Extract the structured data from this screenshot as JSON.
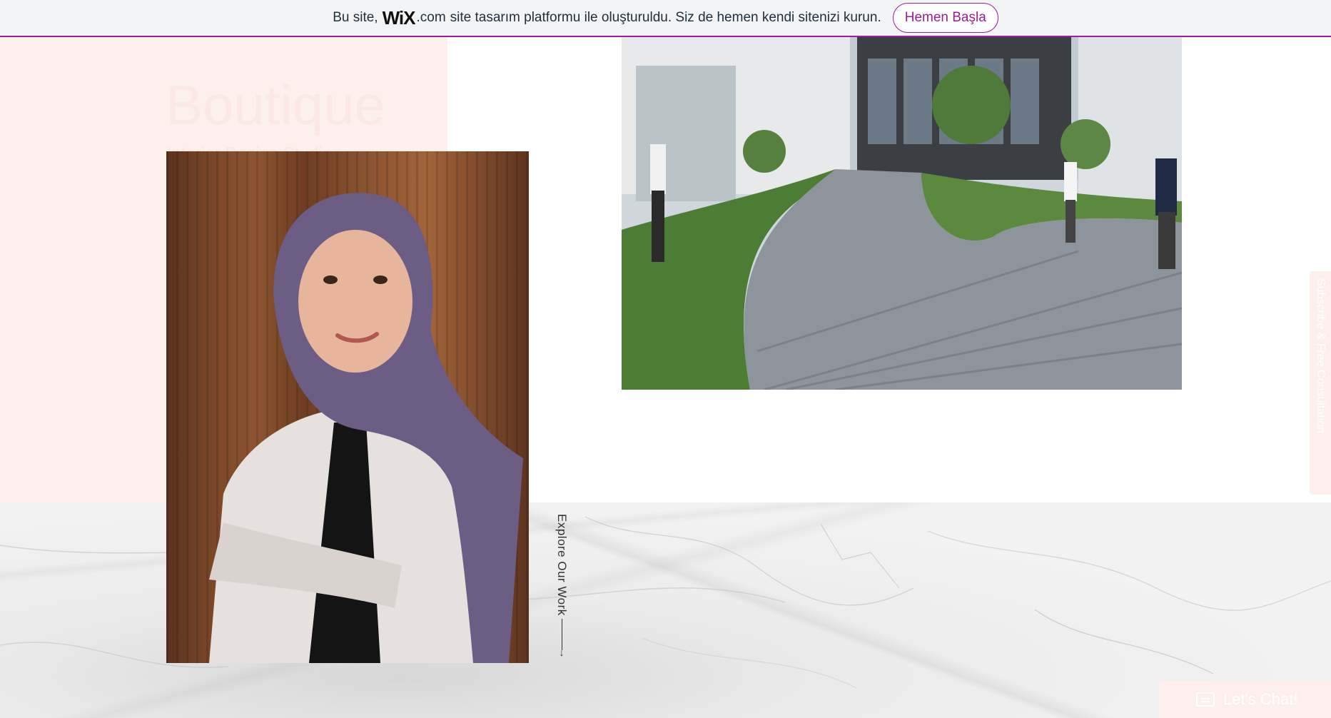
{
  "banner": {
    "prefix": "Bu site,",
    "logo": "WiX",
    "logo_suffix": ".com",
    "message": "site tasarım platformu ile oluşturuldu. Siz de hemen kendi sitenizi kurun.",
    "cta_label": "Hemen Başla",
    "accent_color": "#9b1e96"
  },
  "hero": {
    "ghost_title": "Boutique",
    "ghost_subtitle": "Interior Design Studio"
  },
  "explore": {
    "label": "Explore Our Work"
  },
  "side_tab": {
    "label": "Subscribe & Free Consultation"
  },
  "chat": {
    "label": "Let's Chat!",
    "icon": "chat-icon"
  },
  "colors": {
    "pink_panel": "#fdefec",
    "marble": "#efefef"
  }
}
